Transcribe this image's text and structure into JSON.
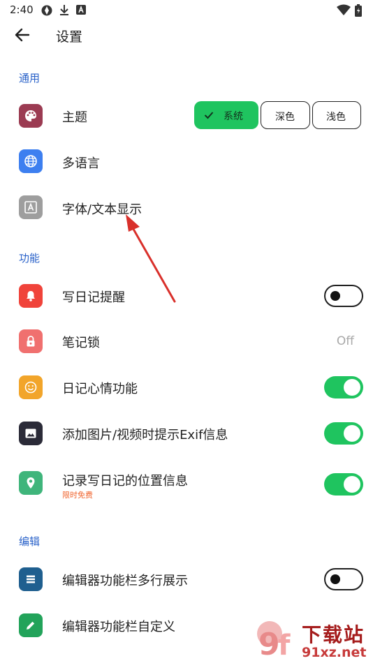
{
  "status_bar": {
    "time": "2:40"
  },
  "app_bar": {
    "title": "设置"
  },
  "sections": {
    "general": "通用",
    "features": "功能",
    "editing": "编辑"
  },
  "rows": {
    "theme": {
      "label": "主题",
      "color": "#9b3b52"
    },
    "language": {
      "label": "多语言",
      "color": "#3d7ff0"
    },
    "font": {
      "label": "字体/文本显示",
      "color": "#9e9e9e"
    },
    "reminder": {
      "label": "写日记提醒",
      "color": "#f0433a"
    },
    "lock": {
      "label": "笔记锁",
      "value": "Off",
      "color": "#f0706f"
    },
    "mood": {
      "label": "日记心情功能",
      "color": "#f2a52a"
    },
    "exif": {
      "label": "添加图片/视频时提示Exif信息",
      "color": "#2b2b38"
    },
    "location": {
      "label": "记录写日记的位置信息",
      "sub": "限时免费",
      "color": "#3fb57b"
    },
    "multiline": {
      "label": "编辑器功能栏多行展示",
      "color": "#1f5f8f"
    },
    "custom_toolbar": {
      "label": "编辑器功能栏自定义",
      "color": "#22a35a"
    }
  },
  "theme_options": {
    "system": "系统",
    "dark": "深色",
    "light": "浅色",
    "selected": "system"
  },
  "toggles": {
    "reminder": false,
    "mood": true,
    "exif": true,
    "location": true,
    "multiline": false
  },
  "watermark": {
    "text1": "下载站",
    "text2": "91xz.net"
  },
  "colors": {
    "accent": "#1fc45f",
    "section": "#2a62c9",
    "badge": "#f0652f"
  }
}
